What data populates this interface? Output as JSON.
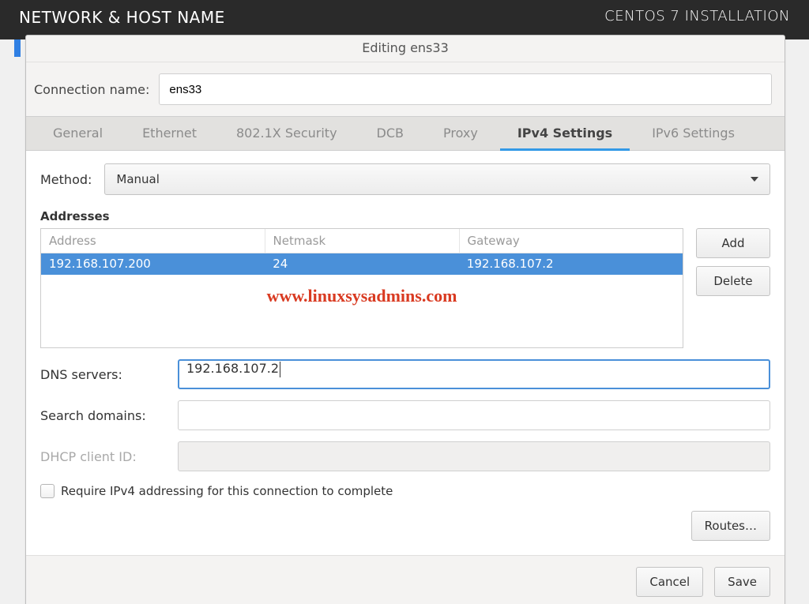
{
  "topbar": {
    "left": "NETWORK & HOST NAME",
    "right": "CENTOS 7 INSTALLATION"
  },
  "dialog": {
    "title": "Editing ens33",
    "connection_label": "Connection name:",
    "connection_value": "ens33"
  },
  "tabs": {
    "general": "General",
    "ethernet": "Ethernet",
    "security": "802.1X Security",
    "dcb": "DCB",
    "proxy": "Proxy",
    "ipv4": "IPv4 Settings",
    "ipv6": "IPv6 Settings"
  },
  "ipv4": {
    "method_label": "Method:",
    "method_value": "Manual",
    "addresses_title": "Addresses",
    "headers": {
      "address": "Address",
      "netmask": "Netmask",
      "gateway": "Gateway"
    },
    "rows": [
      {
        "address": "192.168.107.200",
        "netmask": "24",
        "gateway": "192.168.107.2"
      }
    ],
    "buttons": {
      "add": "Add",
      "delete": "Delete"
    },
    "dns_label": "DNS servers:",
    "dns_value": "192.168.107.2",
    "search_label": "Search domains:",
    "search_value": "",
    "dhcp_label": "DHCP client ID:",
    "dhcp_value": "",
    "require_label": "Require IPv4 addressing for this connection to complete",
    "routes_label": "Routes…"
  },
  "footer": {
    "cancel": "Cancel",
    "save": "Save"
  },
  "watermark": "www.linuxsysadmins.com"
}
